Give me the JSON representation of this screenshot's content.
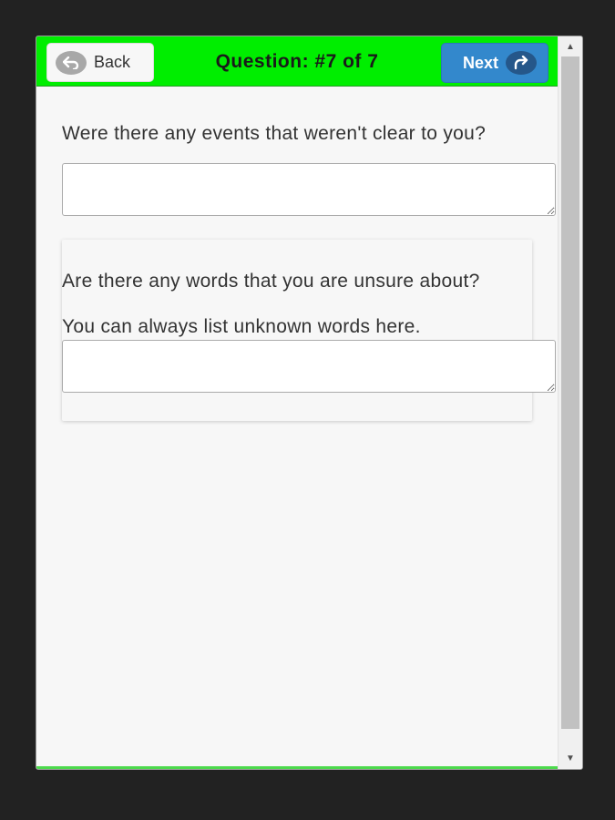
{
  "header": {
    "back_label": "Back",
    "title": "Question: #7 of 7",
    "next_label": "Next",
    "colors": {
      "bar": "#00ee00",
      "next_button": "#3388cc"
    }
  },
  "questions": [
    {
      "text": "Were there any events that weren't clear to you?",
      "answer": ""
    },
    {
      "text": "Are there any words that you are unsure about?",
      "hint": "You can always list unknown words here.",
      "answer": ""
    }
  ],
  "icons": {
    "back": "back-arrow-icon",
    "next": "redo-arrow-icon"
  }
}
